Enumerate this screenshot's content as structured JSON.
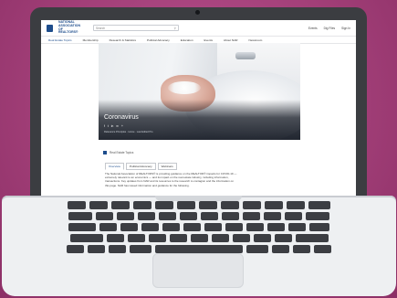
{
  "site": {
    "logo_line1": "NATIONAL",
    "logo_line2": "ASSOCIATION OF",
    "logo_line3": "REALTORS®",
    "search_placeholder": "Search",
    "top_links": [
      "Events",
      "Dig Files",
      "Sign In"
    ],
    "nav": [
      "Real Estate Topics",
      "Membership",
      "Research & Statistics",
      "Political Advocacy",
      "Education",
      "Events",
      "About NAR",
      "Newsroom"
    ]
  },
  "hero": {
    "title": "Coronavirus",
    "social": [
      "f",
      "t",
      "in",
      "✉",
      "+"
    ],
    "meta": "Relevance Principles · Home · Last Edited Pro"
  },
  "breadcrumb": "Real Estate Topics",
  "tabs": [
    "Overview",
    "Political Advocacy",
    "Webinars"
  ],
  "content": {
    "line1": "The National Association of REALTORS® is providing guidance on the REALTOR® impacts for COVID-19 —",
    "line2": "extremely relevant to an economics — and its impact on the real estate industry, including information,",
    "line3": "transactions. Key updates from NAR and its resources to the research to contagion and the information on",
    "line4": "this page. NAR has issued information and guidance for the following."
  },
  "colors": {
    "background": "#a8407e",
    "brand": "#1e4d8c",
    "laptop": "#3b3d41"
  }
}
